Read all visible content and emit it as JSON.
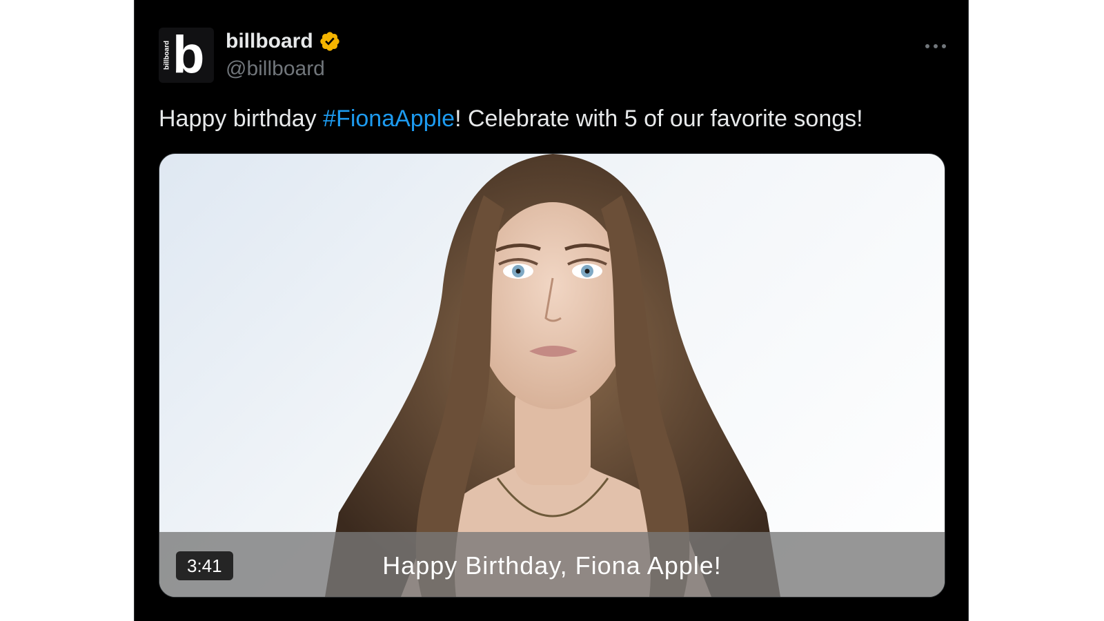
{
  "author": {
    "name": "billboard",
    "handle": "@billboard",
    "avatar_letter": "b",
    "avatar_word": "billboard",
    "verified": true,
    "verified_color": "#f4b400"
  },
  "post": {
    "text_before": "Happy birthday ",
    "hashtag": "#FionaApple",
    "text_after": "! Celebrate with 5 of our favorite songs!",
    "link_color": "#1d9bf0"
  },
  "media": {
    "type": "video",
    "duration": "3:41",
    "caption": "Happy Birthday, Fiona Apple!"
  },
  "icons": {
    "more": "more-options-icon",
    "verified": "verified-badge-icon"
  }
}
